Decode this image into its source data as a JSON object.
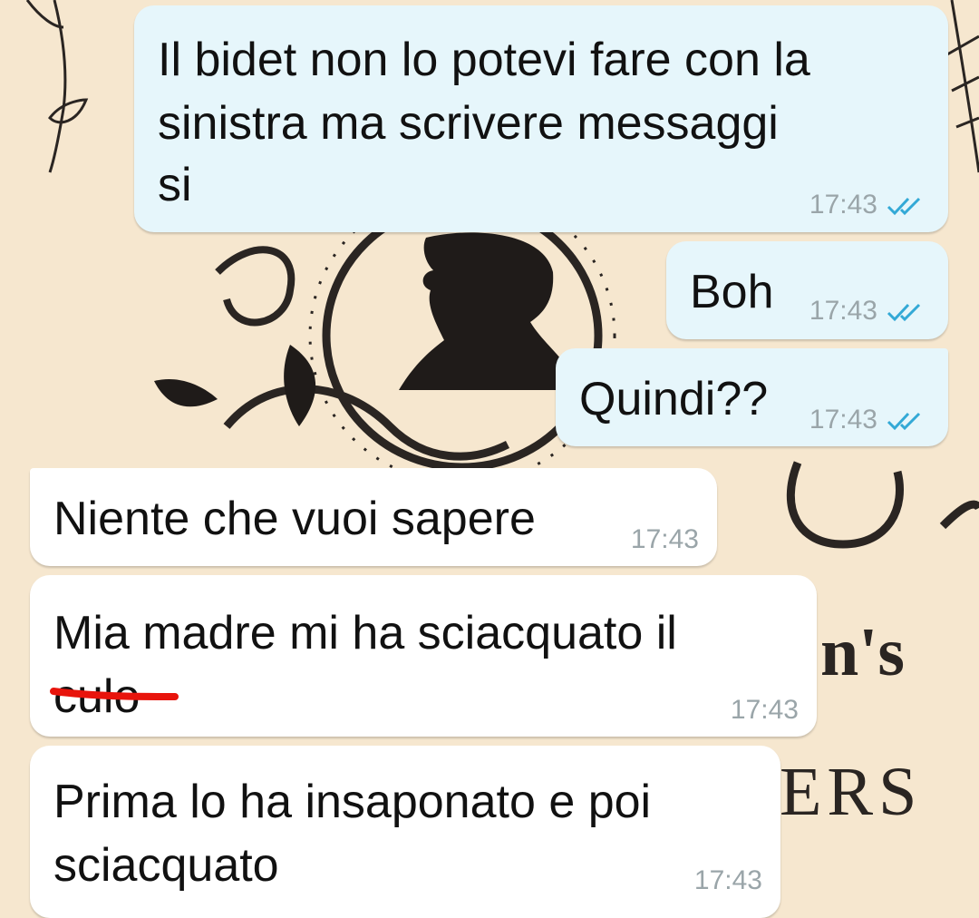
{
  "wallpaper": {
    "fragment_1": "n's",
    "fragment_2": "ERS"
  },
  "colors": {
    "outgoing_bubble": "#e6f6fb",
    "incoming_bubble": "#ffffff",
    "read_ticks": "#33a9d6",
    "strike": "#e8140c",
    "timestamp": "#9aa5a9"
  },
  "messages": [
    {
      "direction": "outgoing",
      "lines": [
        "Il bidet non lo potevi fare con la",
        "sinistra ma scrivere messaggi",
        "si"
      ],
      "time": "17:43",
      "status_icon": "double-check-read-icon"
    },
    {
      "direction": "outgoing",
      "lines": [
        "Boh"
      ],
      "time": "17:43",
      "status_icon": "double-check-read-icon"
    },
    {
      "direction": "outgoing",
      "lines": [
        "Quindi??"
      ],
      "time": "17:43",
      "status_icon": "double-check-read-icon"
    },
    {
      "direction": "incoming",
      "lines": [
        "Niente che vuoi sapere"
      ],
      "time": "17:43"
    },
    {
      "direction": "incoming",
      "lines": [
        "Mia madre mi ha sciacquato il",
        "culo"
      ],
      "time": "17:43",
      "struck_word": "culo"
    },
    {
      "direction": "incoming",
      "lines": [
        "Prima lo ha insaponato e poi",
        "sciacquato"
      ],
      "time": "17:43"
    }
  ]
}
